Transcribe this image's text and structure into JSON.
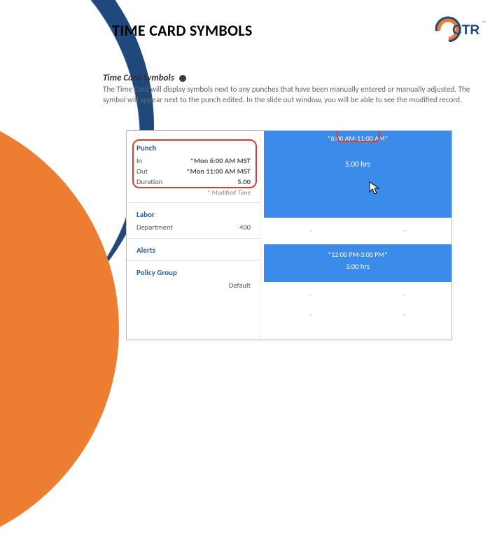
{
  "title": "TIME CARD SYMBOLS",
  "logo_text": "CTR",
  "subhead": "Time Card Symbols",
  "description": "The Time Card will display symbols next to any punches that have been manually entered or manually adjusted. The symbol will appear next to the punch edited. In the slide out window, you will be able to see the modified record.",
  "panel": {
    "punch_header": "Punch",
    "in_label": "In",
    "in_value": "*Mon 6:00 AM MST",
    "out_label": "Out",
    "out_value": "*Mon 11:00 AM MST",
    "duration_label": "Duration",
    "duration_value": "5.00",
    "modified_note": "* Modified Time",
    "labor_header": "Labor",
    "dept_label": "Department",
    "dept_value": "400",
    "alerts_header": "Alerts",
    "policy_header": "Policy Group",
    "policy_value": "Default"
  },
  "block1": {
    "range": "*6:00 AM-11:00 AM*",
    "hours": "5.00 hrs"
  },
  "block2": {
    "range": "*12:00 PM-3:00 PM*",
    "hours": "3.00 hrs"
  },
  "placeholder_dash": "–"
}
